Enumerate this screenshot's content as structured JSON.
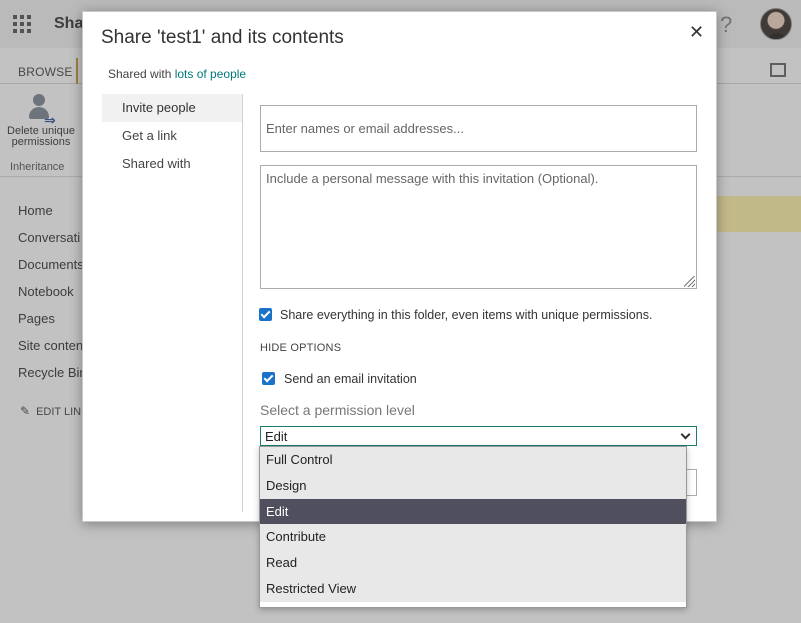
{
  "background": {
    "suite_title": "Sha",
    "help_glyph": "?",
    "ribbon": {
      "tab_browse": "BROWSE",
      "delete_button_label": "Delete unique permissions",
      "group_label": "Inheritance"
    },
    "quick_launch": [
      "Home",
      "Conversati",
      "Documents",
      "Notebook",
      "Pages",
      "Site conten",
      "Recycle Bin"
    ],
    "edit_links": "EDIT LIN"
  },
  "dialog": {
    "title": "Share 'test1' and its contents",
    "close_glyph": "✕",
    "shared_with_prefix": "Shared with ",
    "shared_with_link": "lots of people",
    "nav": [
      "Invite people",
      "Get a link",
      "Shared with"
    ],
    "names_placeholder": "Enter names or email addresses...",
    "message_placeholder": "Include a personal message with this invitation (Optional).",
    "share_everything_label": "Share everything in this folder, even items with unique permissions.",
    "hide_options": "HIDE OPTIONS",
    "send_email_label": "Send an email invitation",
    "permission_label": "Select a permission level",
    "permission_selected": "Edit",
    "permission_options": [
      "Full Control",
      "Design",
      "Edit",
      "Contribute",
      "Read",
      "Restricted View"
    ]
  },
  "colors": {
    "accent_teal": "#03787c",
    "checkbox_blue": "#1a73c8",
    "selected_option_bg": "#4f4f5e"
  }
}
